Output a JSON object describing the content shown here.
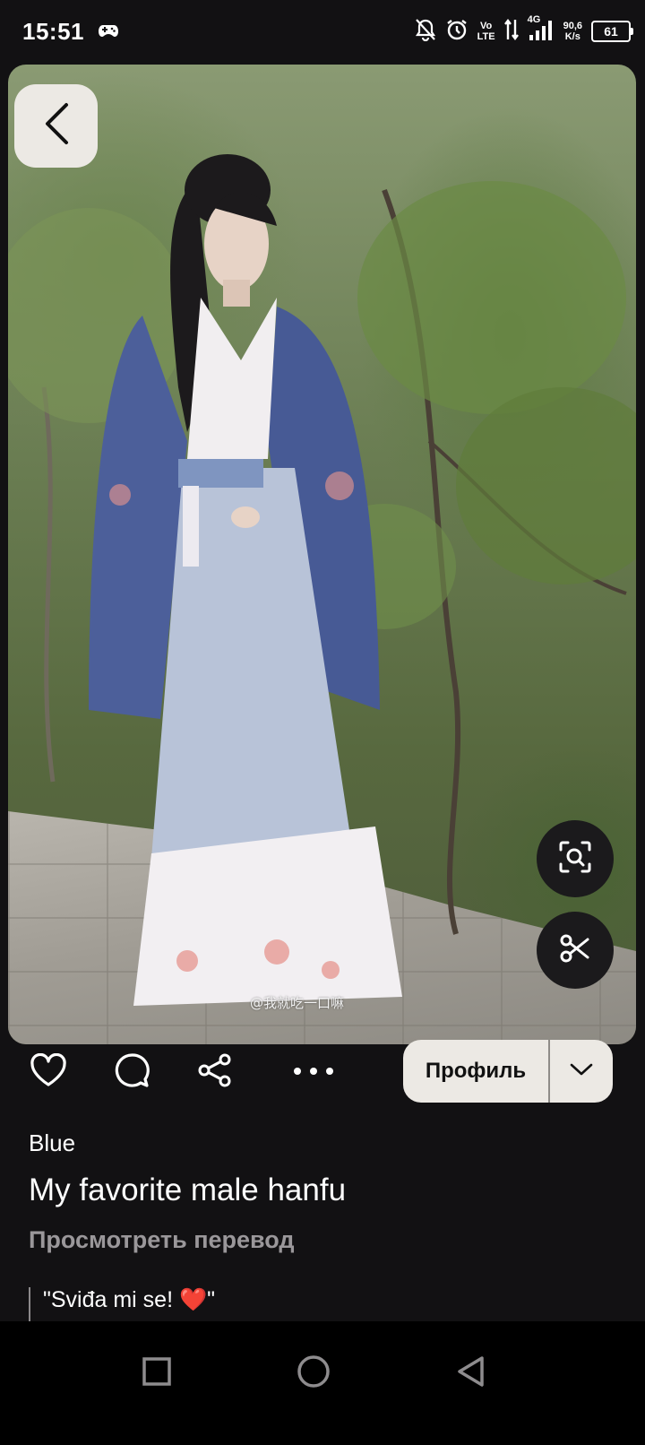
{
  "status_bar": {
    "time": "15:51",
    "network_top": "Vo",
    "network_bottom": "LTE",
    "signal_type": "4G",
    "speed_top": "90,6",
    "speed_bottom": "K/s",
    "battery": "61",
    "icons": [
      "gamepad-icon",
      "bell-off-icon",
      "alarm-icon",
      "data-arrows-icon",
      "signal-icon"
    ]
  },
  "pin": {
    "watermark": "@我就吃一口嘛"
  },
  "actions": {
    "profile_label": "Профиль"
  },
  "content": {
    "author": "Blue",
    "title": "My favorite male hanfu",
    "translate_link": "Просмотреть перевод",
    "comment": "\"Sviđa mi se! ❤️\""
  },
  "colors": {
    "background": "#121113",
    "button_light": "#ece9e4",
    "muted_text": "#9a979a",
    "heart": "#e53935"
  }
}
